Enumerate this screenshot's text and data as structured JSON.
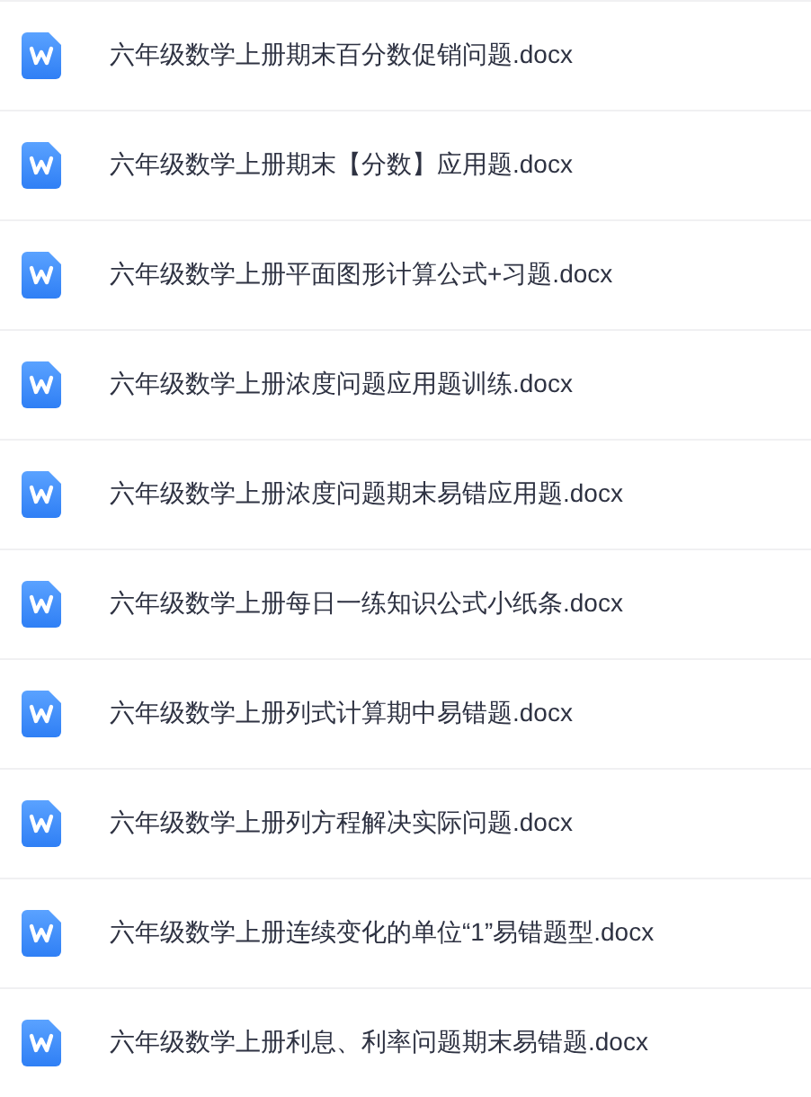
{
  "files": [
    {
      "name": "六年级数学上册期末百分数促销问题.docx"
    },
    {
      "name": "六年级数学上册期末【分数】应用题.docx"
    },
    {
      "name": "六年级数学上册平面图形计算公式+习题.docx"
    },
    {
      "name": "六年级数学上册浓度问题应用题训练.docx"
    },
    {
      "name": "六年级数学上册浓度问题期末易错应用题.docx"
    },
    {
      "name": "六年级数学上册每日一练知识公式小纸条.docx"
    },
    {
      "name": "六年级数学上册列式计算期中易错题.docx"
    },
    {
      "name": "六年级数学上册列方程解决实际问题.docx"
    },
    {
      "name": "六年级数学上册连续变化的单位“1”易错题型.docx"
    },
    {
      "name": "六年级数学上册利息、利率问题期末易错题.docx"
    }
  ]
}
